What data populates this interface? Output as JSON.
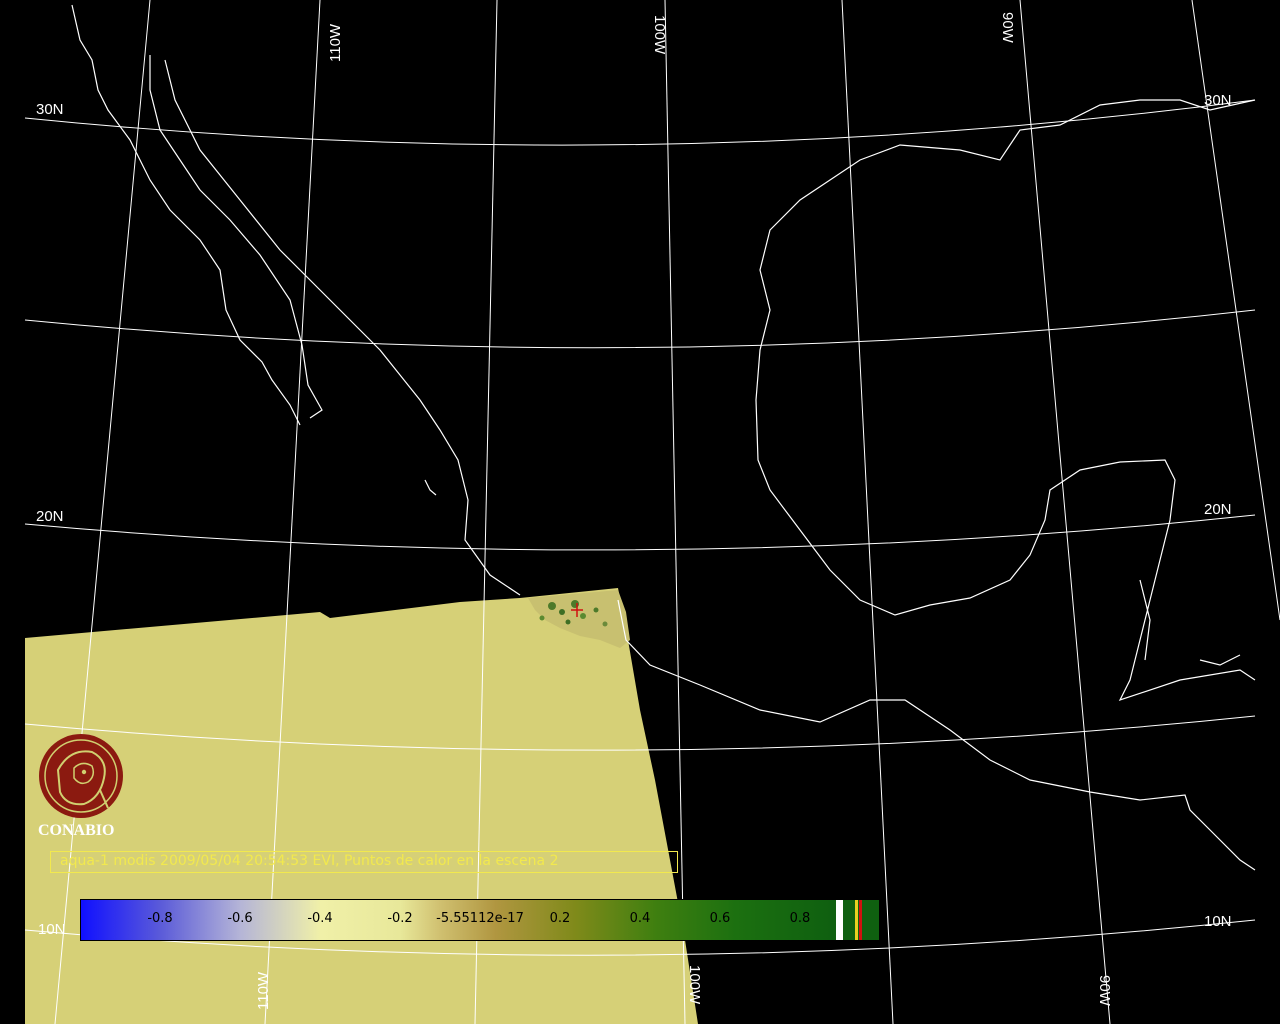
{
  "map": {
    "graticule_labels": {
      "lat_30n_left": "30N",
      "lat_30n_right": "30N",
      "lat_20n_left": "20N",
      "lat_20n_right": "20N",
      "lat_10n_left": "10N",
      "lat_10n_right": "10N",
      "lon_110w_top": "110W",
      "lon_100w_top": "100W",
      "lon_90w_top": "90W",
      "lon_110w_bottom": "110W",
      "lon_100w_bottom": "100W",
      "lon_90w_bottom": "90W"
    },
    "swath_color": "#d6d077",
    "coast_color": "#ffffff",
    "hotspot_color": "#d01010"
  },
  "logo": {
    "name": "CONABIO",
    "color": "#8b1a10"
  },
  "caption": {
    "text": "aqua-1 modis 2009/05/04 20:54:53 EVI, Puntos de calor en la escena 2",
    "color": "#f2e94e"
  },
  "colorbar": {
    "ticks": [
      "-0.8",
      "-0.6",
      "-0.4",
      "-0.2",
      "-5.55112e-17",
      "0.2",
      "0.4",
      "0.6",
      "0.8"
    ],
    "stripe_colors": [
      "#ffffff",
      "#ffffff",
      "#e8d020",
      "#d01010"
    ]
  }
}
